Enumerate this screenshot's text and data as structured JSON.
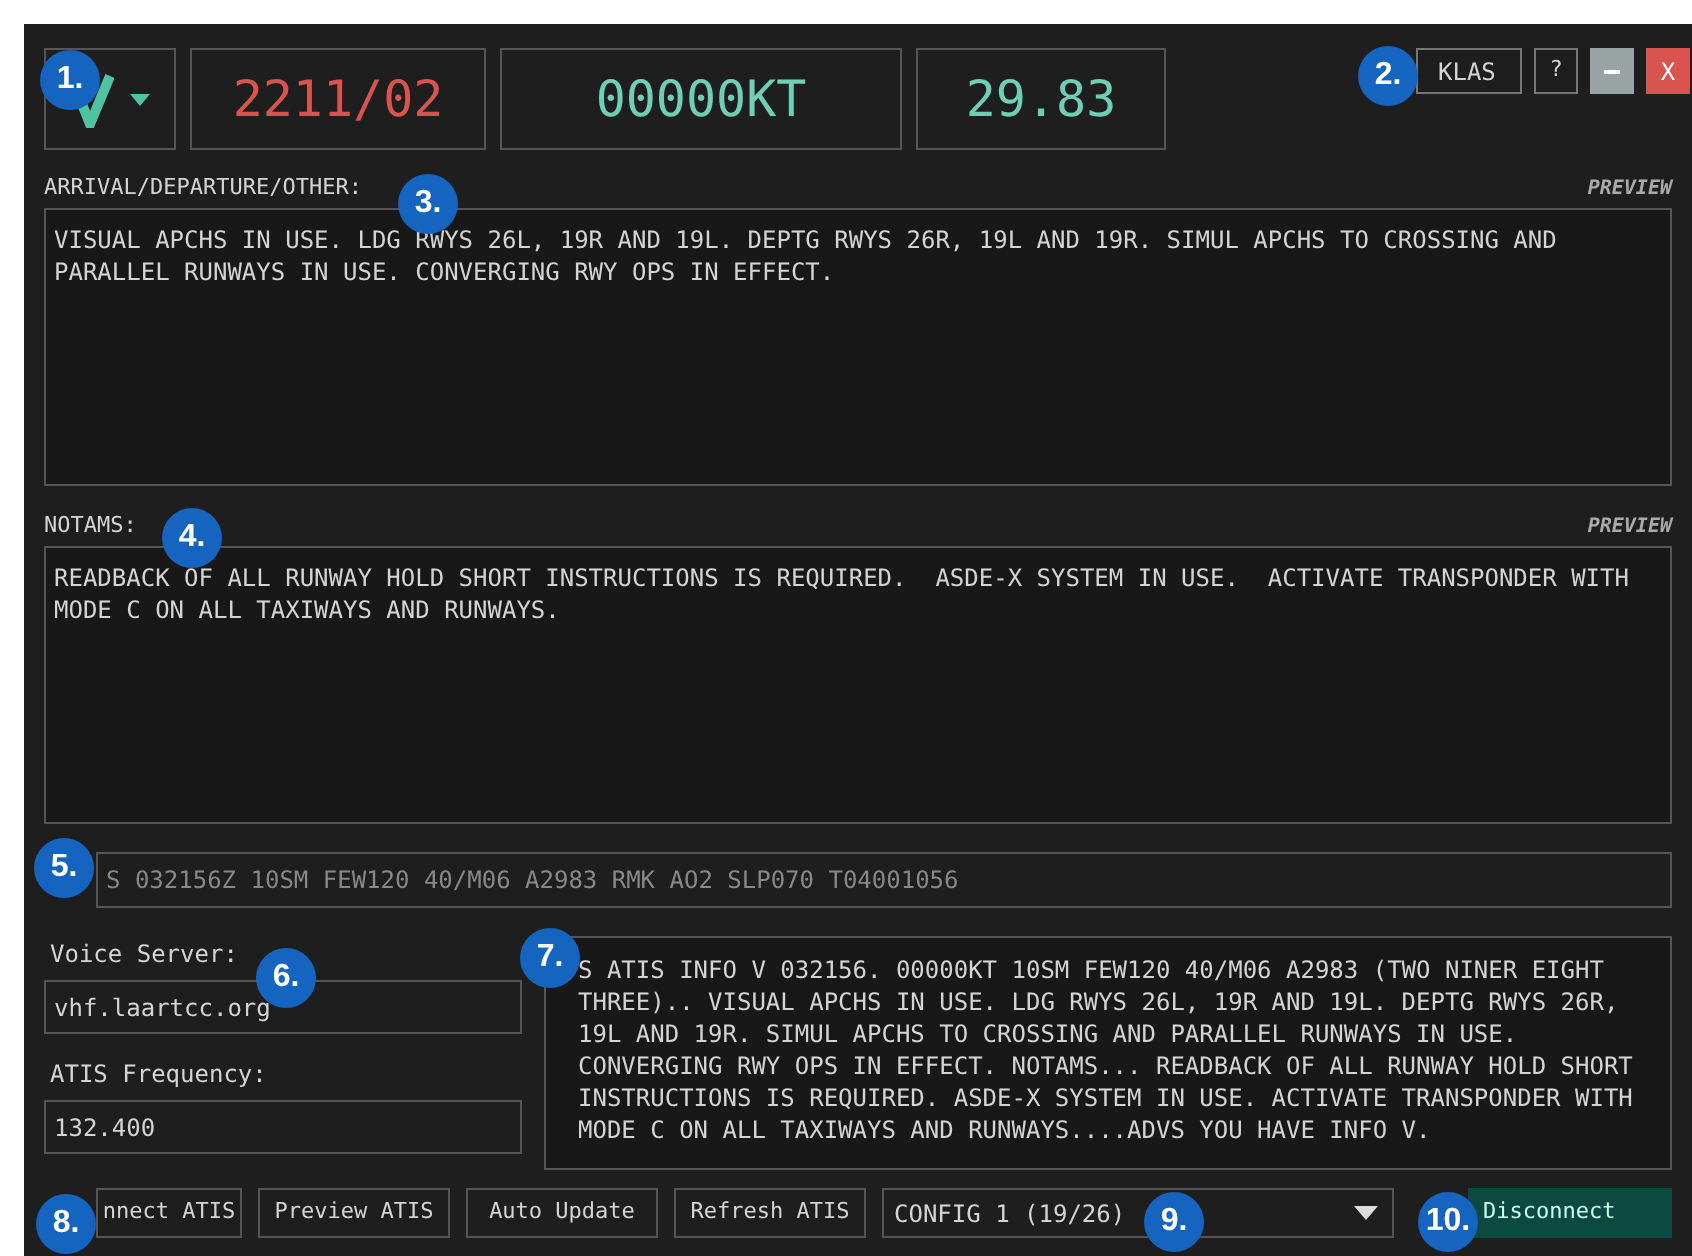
{
  "header": {
    "date": "2211/02",
    "wind": "00000KT",
    "altimeter": "29.83",
    "airport_button": "KLAS",
    "help_button": "?",
    "close_button": "X"
  },
  "arrival": {
    "label": "ARRIVAL/DEPARTURE/OTHER:",
    "preview": "PREVIEW",
    "text": "VISUAL APCHS IN USE. LDG RWYS 26L, 19R AND 19L. DEPTG RWYS 26R, 19L AND 19R. SIMUL APCHS TO CROSSING AND PARALLEL RUNWAYS IN USE. CONVERGING RWY OPS IN EFFECT."
  },
  "notams": {
    "label": "NOTAMS:",
    "preview": "PREVIEW",
    "text": "READBACK OF ALL RUNWAY HOLD SHORT INSTRUCTIONS IS REQUIRED.  ASDE-X SYSTEM IN USE.  ACTIVATE TRANSPONDER WITH MODE C ON ALL TAXIWAYS AND RUNWAYS."
  },
  "metar": "S 032156Z 10SM FEW120 40/M06 A2983 RMK AO2 SLP070 T04001056",
  "voice_server": {
    "label": "Voice Server:",
    "value": "vhf.laartcc.org"
  },
  "atis_frequency": {
    "label": "ATIS Frequency:",
    "value": "132.400"
  },
  "atis_text": "S ATIS INFO V 032156. 00000KT 10SM FEW120 40/M06 A2983 (TWO NINER EIGHT THREE).. VISUAL APCHS IN USE. LDG RWYS 26L, 19R AND 19L. DEPTG RWYS 26R, 19L AND 19R. SIMUL APCHS TO CROSSING AND PARALLEL RUNWAYS IN USE. CONVERGING RWY OPS IN EFFECT. NOTAMS... READBACK OF ALL RUNWAY HOLD SHORT INSTRUCTIONS IS REQUIRED. ASDE-X SYSTEM IN USE. ACTIVATE TRANSPONDER WITH MODE C ON ALL TAXIWAYS AND RUNWAYS....ADVS YOU HAVE INFO V.",
  "buttons": [
    {
      "label": "nnect ATIS"
    },
    {
      "label": "Preview ATIS"
    },
    {
      "label": "Auto Update"
    },
    {
      "label": "Refresh ATIS"
    }
  ],
  "config": "CONFIG 1 (19/26)",
  "disconnect": "Disconnect",
  "callouts": [
    "1.",
    "2.",
    "3.",
    "4.",
    "5.",
    "6.",
    "7.",
    "8.",
    "9.",
    "10."
  ]
}
